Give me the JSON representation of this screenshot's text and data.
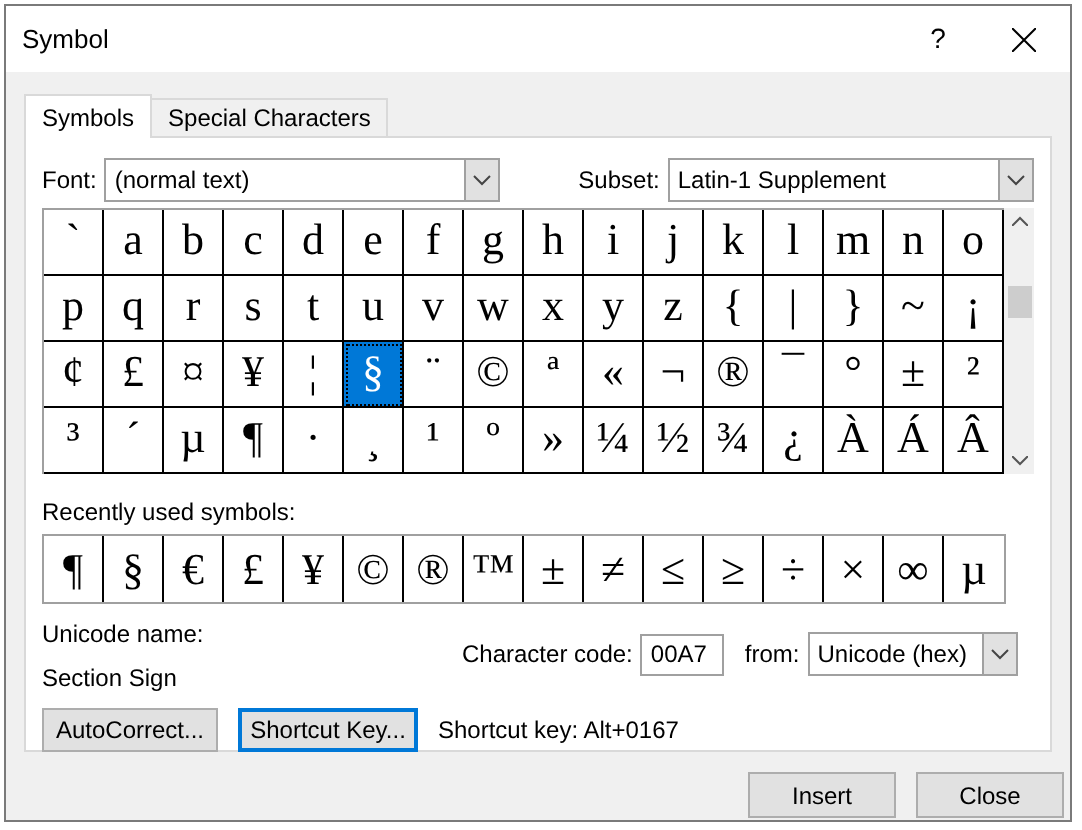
{
  "window": {
    "title": "Symbol",
    "help": "?"
  },
  "tabs": [
    {
      "label": "Symbols",
      "selected": true
    },
    {
      "label": "Special Characters",
      "selected": false
    }
  ],
  "font": {
    "label": "Font:",
    "value": "(normal text)"
  },
  "subset": {
    "label": "Subset:",
    "value": "Latin-1 Supplement"
  },
  "symbols": [
    {
      "char": "`",
      "selected": false
    },
    {
      "char": "a",
      "selected": false
    },
    {
      "char": "b",
      "selected": false
    },
    {
      "char": "c",
      "selected": false
    },
    {
      "char": "d",
      "selected": false
    },
    {
      "char": "e",
      "selected": false
    },
    {
      "char": "f",
      "selected": false
    },
    {
      "char": "g",
      "selected": false
    },
    {
      "char": "h",
      "selected": false
    },
    {
      "char": "i",
      "selected": false
    },
    {
      "char": "j",
      "selected": false
    },
    {
      "char": "k",
      "selected": false
    },
    {
      "char": "l",
      "selected": false
    },
    {
      "char": "m",
      "selected": false
    },
    {
      "char": "n",
      "selected": false
    },
    {
      "char": "o",
      "selected": false
    },
    {
      "char": "p",
      "selected": false
    },
    {
      "char": "q",
      "selected": false
    },
    {
      "char": "r",
      "selected": false
    },
    {
      "char": "s",
      "selected": false
    },
    {
      "char": "t",
      "selected": false
    },
    {
      "char": "u",
      "selected": false
    },
    {
      "char": "v",
      "selected": false
    },
    {
      "char": "w",
      "selected": false
    },
    {
      "char": "x",
      "selected": false
    },
    {
      "char": "y",
      "selected": false
    },
    {
      "char": "z",
      "selected": false
    },
    {
      "char": "{",
      "selected": false
    },
    {
      "char": "|",
      "selected": false
    },
    {
      "char": "}",
      "selected": false
    },
    {
      "char": "~",
      "selected": false
    },
    {
      "char": "¡",
      "selected": false
    },
    {
      "char": "¢",
      "selected": false
    },
    {
      "char": "£",
      "selected": false
    },
    {
      "char": "¤",
      "selected": false
    },
    {
      "char": "¥",
      "selected": false
    },
    {
      "char": "¦",
      "selected": false
    },
    {
      "char": "§",
      "selected": true
    },
    {
      "char": "¨",
      "selected": false
    },
    {
      "char": "©",
      "selected": false
    },
    {
      "char": "ª",
      "selected": false
    },
    {
      "char": "«",
      "selected": false
    },
    {
      "char": "¬",
      "selected": false
    },
    {
      "char": "®",
      "selected": false
    },
    {
      "char": "¯",
      "selected": false
    },
    {
      "char": "°",
      "selected": false
    },
    {
      "char": "±",
      "selected": false
    },
    {
      "char": "²",
      "selected": false
    },
    {
      "char": "³",
      "selected": false
    },
    {
      "char": "´",
      "selected": false
    },
    {
      "char": "µ",
      "selected": false
    },
    {
      "char": "¶",
      "selected": false
    },
    {
      "char": "·",
      "selected": false
    },
    {
      "char": "¸",
      "selected": false
    },
    {
      "char": "¹",
      "selected": false
    },
    {
      "char": "º",
      "selected": false
    },
    {
      "char": "»",
      "selected": false
    },
    {
      "char": "¼",
      "selected": false
    },
    {
      "char": "½",
      "selected": false
    },
    {
      "char": "¾",
      "selected": false
    },
    {
      "char": "¿",
      "selected": false
    },
    {
      "char": "À",
      "selected": false
    },
    {
      "char": "Á",
      "selected": false
    },
    {
      "char": "Â",
      "selected": false
    }
  ],
  "recent": {
    "label": "Recently used symbols:",
    "symbols": [
      "¶",
      "§",
      "€",
      "£",
      "¥",
      "©",
      "®",
      "™",
      "±",
      "≠",
      "≤",
      "≥",
      "÷",
      "×",
      "∞",
      "µ"
    ]
  },
  "unicode_name": {
    "label": "Unicode name:",
    "value": "Section Sign"
  },
  "character_code": {
    "label": "Character code:",
    "value": "00A7"
  },
  "from": {
    "label": "from:",
    "value": "Unicode (hex)"
  },
  "autocorrect_button": "AutoCorrect...",
  "shortcut_key_button": "Shortcut Key...",
  "shortcut_key_text": "Shortcut key: Alt+0167",
  "buttons": [
    "Insert",
    "Close"
  ]
}
